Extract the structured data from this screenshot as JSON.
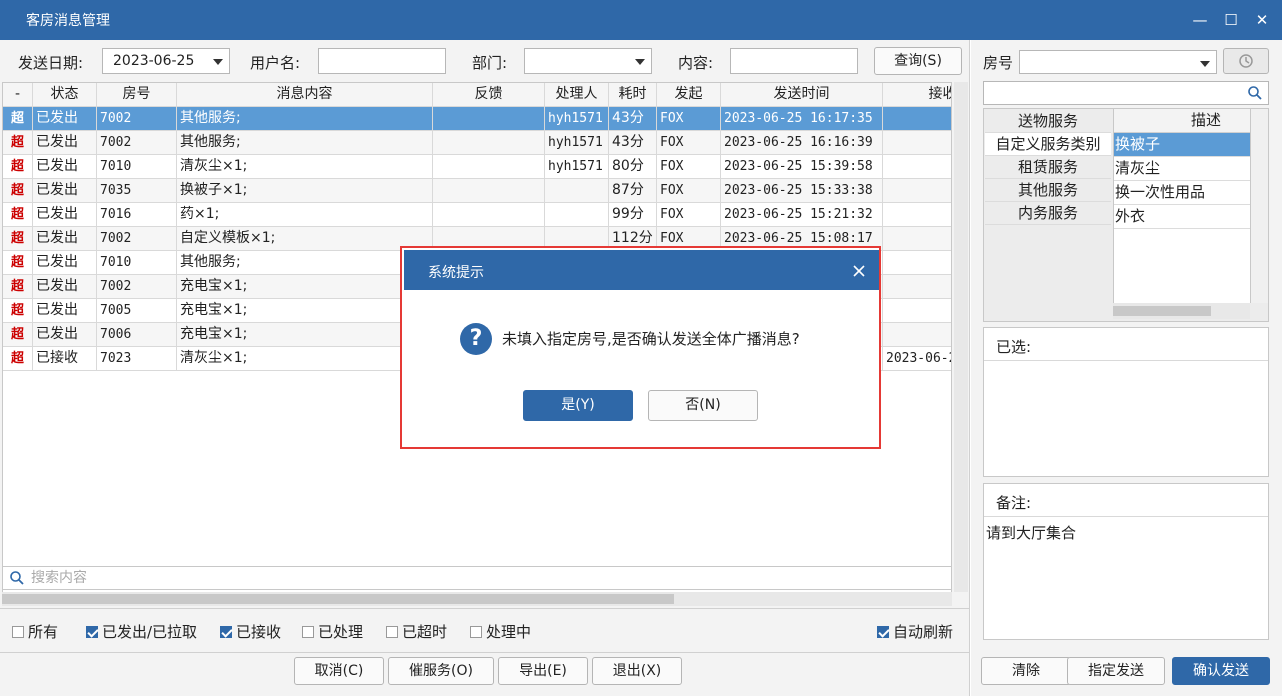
{
  "window": {
    "title": "客房消息管理",
    "minimize": "—",
    "maximize": "☐",
    "close": "✕"
  },
  "filters": {
    "date_label": "发送日期:",
    "date_value": "2023-06-25",
    "user_label": "用户名:",
    "dept_label": "部门:",
    "content_label": "内容:",
    "query_button": "查询(S)"
  },
  "table": {
    "headers": [
      "-",
      "状态",
      "房号",
      "消息内容",
      "反馈",
      "处理人",
      "耗时",
      "发起",
      "发送时间",
      "接收"
    ],
    "rows": [
      [
        "超",
        "已发出",
        "7002",
        "其他服务;",
        "",
        "hyh1571",
        "43分",
        "FOX",
        "2023-06-25 16:17:35",
        ""
      ],
      [
        "超",
        "已发出",
        "7002",
        "其他服务;",
        "",
        "hyh1571",
        "43分",
        "FOX",
        "2023-06-25 16:16:39",
        ""
      ],
      [
        "超",
        "已发出",
        "7010",
        "清灰尘×1;",
        "",
        "hyh1571",
        "80分",
        "FOX",
        "2023-06-25 15:39:58",
        ""
      ],
      [
        "超",
        "已发出",
        "7035",
        "换被子×1;",
        "",
        "",
        "87分",
        "FOX",
        "2023-06-25 15:33:38",
        ""
      ],
      [
        "超",
        "已发出",
        "7016",
        "药×1;",
        "",
        "",
        "99分",
        "FOX",
        "2023-06-25 15:21:32",
        ""
      ],
      [
        "超",
        "已发出",
        "7002",
        "自定义模板×1;",
        "",
        "",
        "112分",
        "FOX",
        "2023-06-25 15:08:17",
        ""
      ],
      [
        "超",
        "已发出",
        "7010",
        "其他服务;",
        "",
        "",
        "",
        "",
        "",
        ""
      ],
      [
        "超",
        "已发出",
        "7002",
        "充电宝×1;",
        "",
        "",
        "",
        "",
        "",
        ""
      ],
      [
        "超",
        "已发出",
        "7005",
        "充电宝×1;",
        "",
        "",
        "",
        "",
        "",
        ""
      ],
      [
        "超",
        "已发出",
        "7006",
        "充电宝×1;",
        "",
        "",
        "",
        "",
        "",
        ""
      ],
      [
        "超",
        "已接收",
        "7023",
        "清灰尘×1;",
        "",
        "",
        "",
        "",
        "",
        "2023-06-2"
      ]
    ]
  },
  "search": {
    "placeholder": "搜索内容"
  },
  "checkboxes": [
    {
      "label": "所有",
      "checked": false
    },
    {
      "label": "已发出/已拉取",
      "checked": true
    },
    {
      "label": "已接收",
      "checked": true
    },
    {
      "label": "已处理",
      "checked": false
    },
    {
      "label": "已超时",
      "checked": false
    },
    {
      "label": "处理中",
      "checked": false
    },
    {
      "label": "自动刷新",
      "checked": true
    }
  ],
  "bottom_buttons": [
    "取消(C)",
    "催服务(O)",
    "导出(E)",
    "退出(X)"
  ],
  "right": {
    "room_label": "房号",
    "services": [
      "送物服务",
      "自定义服务类别",
      "租赁服务",
      "其他服务",
      "内务服务"
    ],
    "desc_header": "描述",
    "descriptions": [
      "换被子",
      "清灰尘",
      "换一次性用品",
      "外衣"
    ],
    "selected_label": "已选:",
    "remark_label": "备注:",
    "remark_text": "请到大厅集合",
    "buttons": [
      "清除",
      "指定发送",
      "确认发送"
    ]
  },
  "dialog": {
    "title": "系统提示",
    "message": "未填入指定房号,是否确认发送全体广播消息?",
    "yes": "是(Y)",
    "no": "否(N)"
  },
  "colors": {
    "accent": "#2f68a8",
    "selected_row": "#5b9bd5",
    "flag": "#cc0000",
    "dialog_border": "#e53935"
  }
}
